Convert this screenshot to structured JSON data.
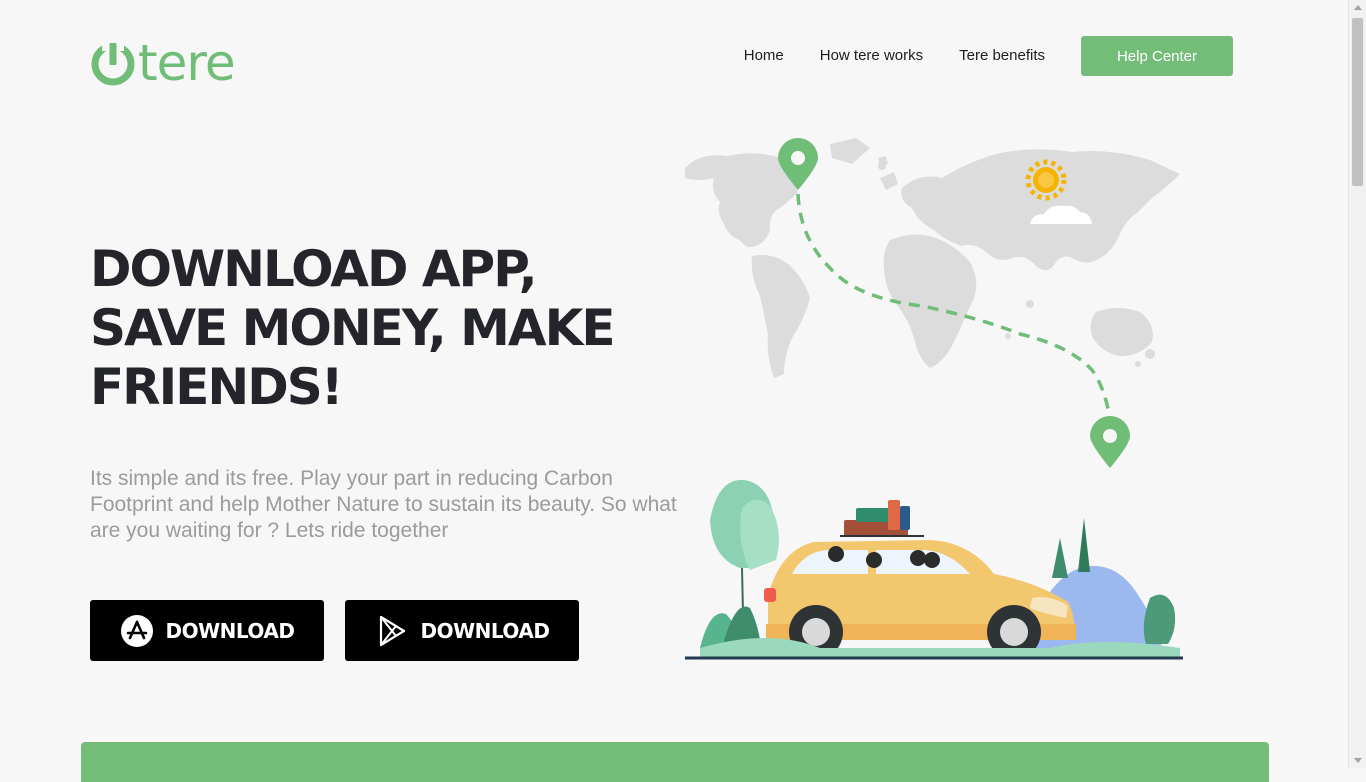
{
  "brand": {
    "name": "tere",
    "color": "#6fbd77"
  },
  "nav": {
    "items": [
      {
        "label": "Home"
      },
      {
        "label": "How tere works"
      },
      {
        "label": "Tere benefits"
      }
    ],
    "help_label": "Help Center"
  },
  "hero": {
    "title_lines": [
      "DOWNLOAD APP,",
      "SAVE MONEY, MAKE",
      "FRIENDS!"
    ],
    "subtitle": "Its simple and its free. Play your part in reducing Carbon Footprint and help Mother Nature to sustain its beauty. So what are you waiting for ? Lets ride together"
  },
  "downloads": [
    {
      "label": "DOWNLOAD",
      "icon": "app-store-icon"
    },
    {
      "label": "DOWNLOAD",
      "icon": "google-play-icon"
    }
  ],
  "illustration": {
    "icons": [
      "map-pin-icon",
      "sun-icon",
      "cloud-icon",
      "car-icon",
      "tree-icon"
    ]
  },
  "colors": {
    "accent": "#73bd79",
    "heading": "#24252a",
    "muted": "#9b9b9b",
    "button": "#000000"
  }
}
